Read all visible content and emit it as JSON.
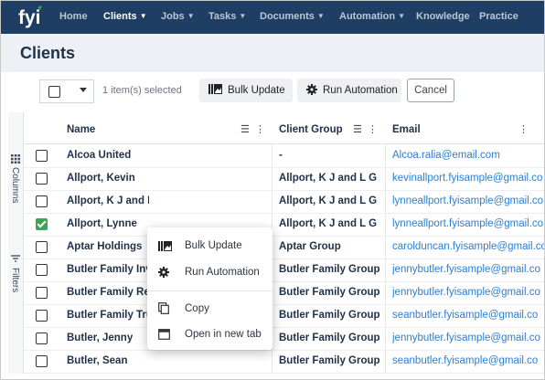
{
  "nav": {
    "logo_text": "fyi",
    "items": [
      {
        "label": "Home",
        "active": false,
        "caret": false
      },
      {
        "label": "Clients",
        "active": true,
        "caret": true
      },
      {
        "label": "Jobs",
        "active": false,
        "caret": true
      },
      {
        "label": "Tasks",
        "active": false,
        "caret": true
      },
      {
        "label": "Documents",
        "active": false,
        "caret": true
      },
      {
        "label": "Automation",
        "active": false,
        "caret": true
      },
      {
        "label": "Knowledge",
        "active": false,
        "caret": false
      },
      {
        "label": "Practice",
        "active": false,
        "caret": false
      }
    ]
  },
  "page": {
    "title": "Clients"
  },
  "toolbar": {
    "selected_text": "1 item(s) selected",
    "bulk_update": "Bulk Update",
    "run_automation": "Run Automation",
    "cancel": "Cancel"
  },
  "side": {
    "columns": "Columns",
    "filters": "Filters"
  },
  "table": {
    "headers": {
      "name": "Name",
      "group": "Client Group",
      "email": "Email"
    },
    "rows": [
      {
        "checked": false,
        "name": "Alcoa United",
        "group": "-",
        "email": "Alcoa.ralia@email.com"
      },
      {
        "checked": false,
        "name": "Allport, Kevin",
        "group": "Allport, K J and L G",
        "email": "kevinallport.fyisample@gmail.co"
      },
      {
        "checked": false,
        "name": "Allport, K J and L G",
        "group": "Allport, K J and L G",
        "email": "lynneallport.fyisample@gmail.co"
      },
      {
        "checked": true,
        "name": "Allport, Lynne",
        "group": "Allport, K J and L G",
        "email": "lynneallport.fyisample@gmail.co"
      },
      {
        "checked": false,
        "name": "Aptar Holdings",
        "group": "Aptar Group",
        "email": "carolduncan.fyisample@gmail.co"
      },
      {
        "checked": false,
        "name": "Butler Family Inves",
        "group": "Butler Family Group",
        "email": "jennybutler.fyisample@gmail.co"
      },
      {
        "checked": false,
        "name": "Butler Family Retir",
        "group": "Butler Family Group",
        "email": "jennybutler.fyisample@gmail.co"
      },
      {
        "checked": false,
        "name": "Butler Family Trust",
        "group": "Butler Family Group",
        "email": "seanbutler.fyisample@gmail.co"
      },
      {
        "checked": false,
        "name": "Butler, Jenny",
        "group": "Butler Family Group",
        "email": "jennybutler.fyisample@gmail.co"
      },
      {
        "checked": false,
        "name": "Butler, Sean",
        "group": "Butler Family Group",
        "email": "seanbutler.fyisample@gmail.co"
      }
    ]
  },
  "context_menu": {
    "items": [
      {
        "label": "Bulk Update",
        "icon": "bulk-update-icon"
      },
      {
        "label": "Run Automation",
        "icon": "gear-icon"
      },
      {
        "label": "Copy",
        "icon": "copy-icon"
      },
      {
        "label": "Open in new tab",
        "icon": "new-tab-icon"
      }
    ]
  },
  "colors": {
    "nav_bg": "#1e3e63",
    "accent_link": "#2a7fd4",
    "check_green": "#3aa553"
  }
}
